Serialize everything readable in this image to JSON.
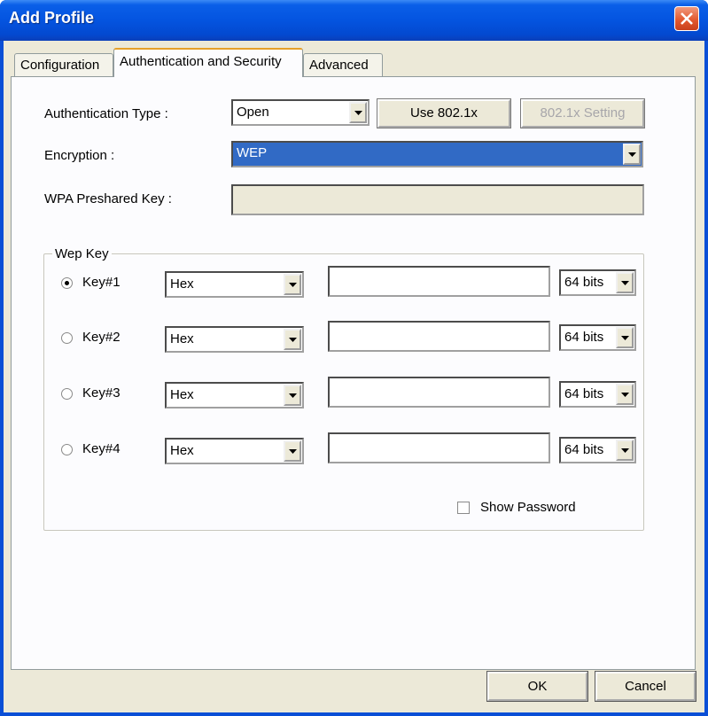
{
  "window": {
    "title": "Add Profile"
  },
  "tabs": [
    {
      "label": "Configuration",
      "active": false
    },
    {
      "label": "Authentication and Security",
      "active": true
    },
    {
      "label": "Advanced",
      "active": false
    }
  ],
  "auth": {
    "type_label": "Authentication Type :",
    "type_value": "Open",
    "use8021x_label": "Use 802.1x",
    "setting8021x_label": "802.1x Setting"
  },
  "encryption": {
    "label": "Encryption :",
    "value": "WEP"
  },
  "wpa": {
    "label": "WPA Preshared Key :",
    "value": ""
  },
  "wepkey": {
    "group_label": "Wep Key",
    "keys": [
      {
        "label": "Key#1",
        "selected": true,
        "format": "Hex",
        "value": "",
        "bits": "64 bits"
      },
      {
        "label": "Key#2",
        "selected": false,
        "format": "Hex",
        "value": "",
        "bits": "64 bits"
      },
      {
        "label": "Key#3",
        "selected": false,
        "format": "Hex",
        "value": "",
        "bits": "64 bits"
      },
      {
        "label": "Key#4",
        "selected": false,
        "format": "Hex",
        "value": "",
        "bits": "64 bits"
      }
    ],
    "show_password_label": "Show Password",
    "show_password_checked": false
  },
  "buttons": {
    "ok": "OK",
    "cancel": "Cancel"
  },
  "colors": {
    "titlebar": "#0454e0",
    "selection": "#316ac5",
    "dialog_bg": "#ece9d8"
  }
}
